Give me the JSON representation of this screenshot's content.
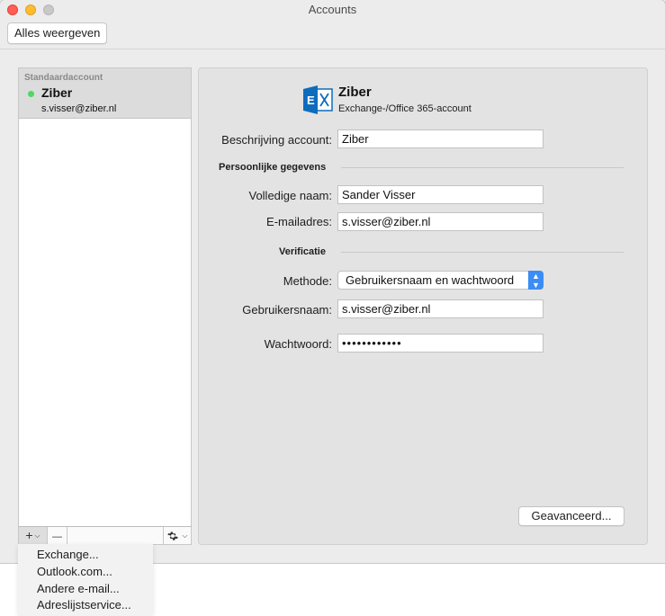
{
  "window": {
    "title": "Accounts"
  },
  "toolbar": {
    "show_all_label": "Alles weergeven"
  },
  "sidebar": {
    "section_header": "Standaardaccount",
    "account": {
      "name": "Ziber",
      "email": "s.visser@ziber.nl",
      "status_color": "#4cd964"
    },
    "add_symbol": "+",
    "remove_symbol": "—",
    "gear_icon": "gear-icon"
  },
  "detail": {
    "account_name": "Ziber",
    "account_type": "Exchange-/Office 365-account",
    "icon": "exchange-icon",
    "description_label": "Beschrijving account:",
    "description_value": "Ziber",
    "personal_section": "Persoonlijke gegevens",
    "fullname_label": "Volledige naam:",
    "fullname_value": "Sander Visser",
    "email_label": "E-mailadres:",
    "email_value": "s.visser@ziber.nl",
    "verification_section": "Verificatie",
    "method_label": "Methode:",
    "method_value": "Gebruikersnaam en wachtwoord",
    "username_label": "Gebruikersnaam:",
    "username_value": "s.visser@ziber.nl",
    "password_label": "Wachtwoord:",
    "password_value": "••••••••••••",
    "advanced_button": "Geavanceerd..."
  },
  "add_menu": {
    "items": [
      "Exchange...",
      "Outlook.com...",
      "Andere e-mail...",
      "Adreslijstservice..."
    ]
  },
  "colors": {
    "accent": "#3b8df5",
    "exchange_blue": "#0f6cbd"
  }
}
